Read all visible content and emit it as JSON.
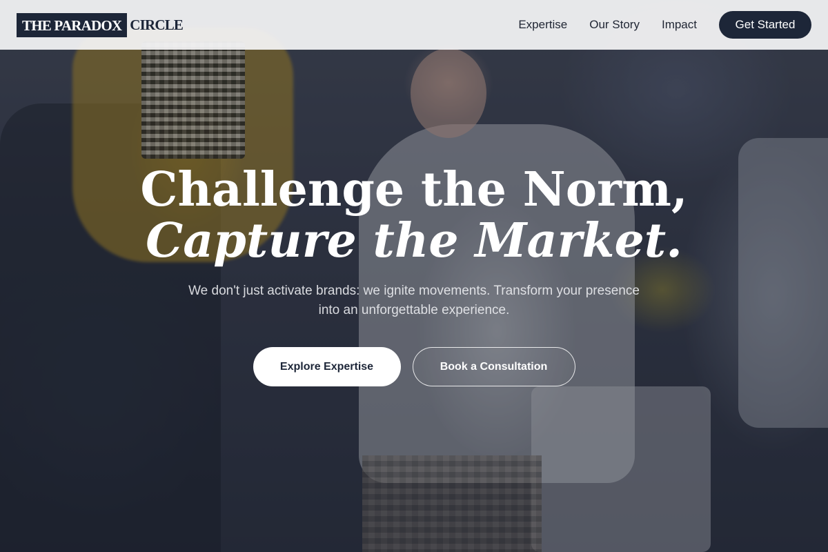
{
  "header": {
    "logo": {
      "dark_part": "THE PARADOX",
      "light_part": "CIRCLE"
    },
    "nav": [
      {
        "label": "Expertise"
      },
      {
        "label": "Our Story"
      },
      {
        "label": "Impact"
      }
    ],
    "cta_label": "Get Started"
  },
  "hero": {
    "headline_line1": "Challenge the Norm,",
    "headline_line2": "Capture the Market.",
    "subcopy": "We don't just activate brands: we ignite movements. Transform your presence into an unforgettable experience.",
    "primary_button": "Explore Expertise",
    "secondary_button": "Book a Consultation",
    "background_image": "event-photo"
  },
  "colors": {
    "brand_navy": "#1d2638",
    "header_bg": "#f5f5f6",
    "text_on_dark": "#ffffff"
  }
}
